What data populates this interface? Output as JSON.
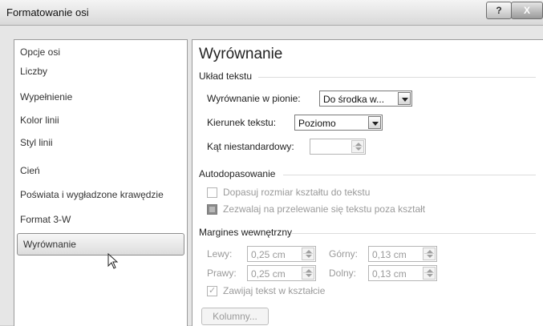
{
  "window": {
    "title": "Formatowanie osi",
    "help_label": "?",
    "close_label": "X"
  },
  "nav": {
    "items": [
      {
        "label": "Opcje osi"
      },
      {
        "label": "Liczby"
      },
      {
        "label": "Wypełnienie"
      },
      {
        "label": "Kolor linii"
      },
      {
        "label": "Styl linii"
      },
      {
        "label": "Cień"
      },
      {
        "label": "Poświata i wygładzone krawędzie"
      },
      {
        "label": "Format 3-W"
      },
      {
        "label": "Wyrównanie"
      }
    ]
  },
  "panel": {
    "heading": "Wyrównanie",
    "text_layout": {
      "section": "Układ tekstu",
      "vertical_label": "Wyrównanie w pionie:",
      "vertical_value": "Do środka w...",
      "direction_label": "Kierunek tekstu:",
      "direction_value": "Poziomo",
      "angle_label": "Kąt niestandardowy:",
      "angle_value": ""
    },
    "autofit": {
      "section": "Autodopasowanie",
      "resize_label": "Dopasuj rozmiar kształtu do tekstu",
      "overflow_label": "Zezwalaj na przelewanie się tekstu poza kształt"
    },
    "margins": {
      "section": "Margines wewnętrzny",
      "left_label": "Lewy:",
      "left_value": "0,25 cm",
      "top_label": "Górny:",
      "top_value": "0,13 cm",
      "right_label": "Prawy:",
      "right_value": "0,25 cm",
      "bottom_label": "Dolny:",
      "bottom_value": "0,13 cm",
      "wrap_label": "Zawijaj tekst w kształcie",
      "columns_button": "Kolumny..."
    }
  }
}
